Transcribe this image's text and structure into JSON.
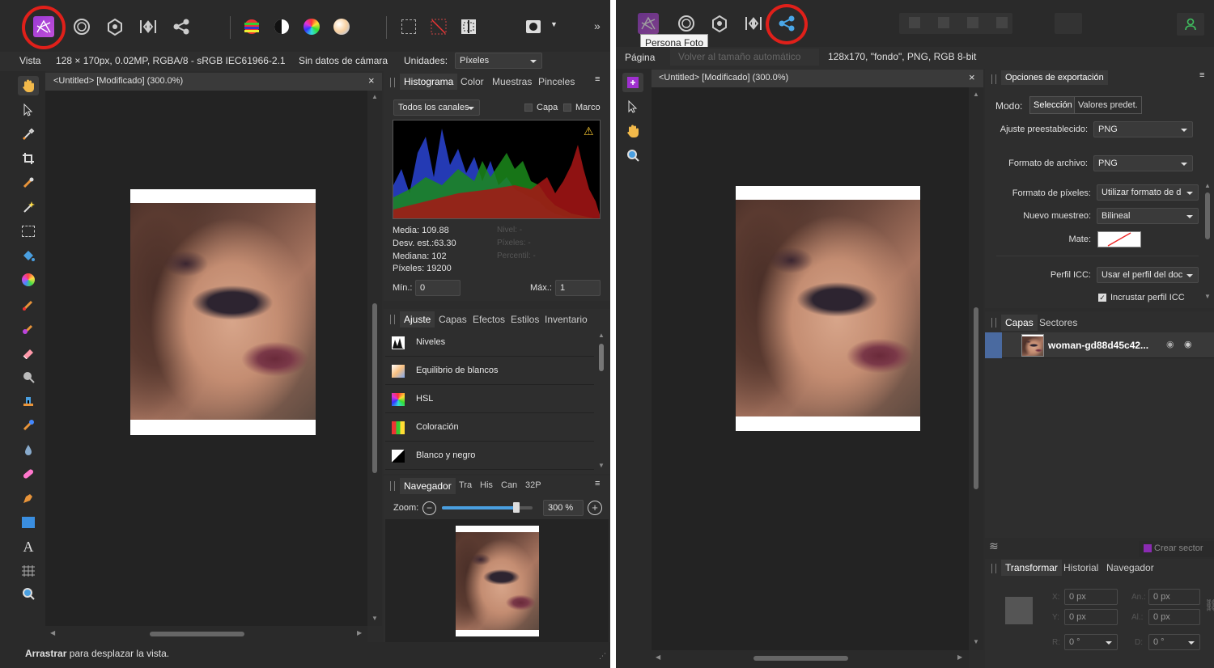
{
  "left": {
    "context": {
      "view_label": "Vista",
      "doc_info": "128 × 170px, 0.02MP, RGBA/8 - sRGB IEC61966-2.1",
      "camera": "Sin datos de cámara",
      "units_label": "Unidades:",
      "units_value": "Píxeles"
    },
    "doc_tab": "<Untitled> [Modificado] (300.0%)",
    "histogram": {
      "tabs": [
        "Histograma",
        "Color",
        "Muestras",
        "Pinceles"
      ],
      "channels": "Todos los canales",
      "layer_label": "Capa",
      "frame_label": "Marco",
      "stats": {
        "mean": "Media: 109.88",
        "stdev": "Desv. est.:63.30",
        "median": "Mediana: 102",
        "pixels": "Píxeles: 19200",
        "level": "Nivel: -",
        "pixels2": "Píxeles: -",
        "percentile": "Percentil: -"
      },
      "min_label": "Mín.:",
      "min_value": "0",
      "max_label": "Máx.:",
      "max_value": "1"
    },
    "adjust": {
      "tabs": [
        "Ajuste",
        "Capas",
        "Efectos",
        "Estilos",
        "Inventario"
      ],
      "items": [
        "Niveles",
        "Equilibrio de blancos",
        "HSL",
        "Coloración",
        "Blanco y negro"
      ]
    },
    "navigator": {
      "tabs": [
        "Navegador",
        "Tra",
        "His",
        "Can",
        "32P"
      ],
      "zoom_label": "Zoom:",
      "zoom_value": "300 %",
      "zoom_fraction": 0.82
    },
    "status_bold": "Arrastrar",
    "status_rest": " para desplazar la vista."
  },
  "right": {
    "tooltip": "Persona Foto",
    "context": {
      "page_label": "Página",
      "auto_size": "Volver al tamaño automático",
      "doc_info": "128x170, \"fondo\", PNG, RGB 8-bit"
    },
    "doc_tab": "<Untitled> [Modificado] (300.0%)",
    "export": {
      "title": "Opciones de exportación",
      "mode_label": "Modo:",
      "mode_selection": "Selección",
      "mode_presets": "Valores predet.",
      "preset_label": "Ajuste preestablecido:",
      "preset_value": "PNG",
      "format_label": "Formato de archivo:",
      "format_value": "PNG",
      "pixel_label": "Formato de píxeles:",
      "pixel_value": "Utilizar formato de d",
      "resample_label": "Nuevo muestreo:",
      "resample_value": "Bilineal",
      "matte_label": "Mate:",
      "icc_label": "Perfil ICC:",
      "icc_value": "Usar el perfil del doc",
      "embed_label": "Incrustar perfil ICC"
    },
    "layers": {
      "tabs": [
        "Capas",
        "Sectores"
      ],
      "layer_name": "woman-gd88d45c42..."
    },
    "create_slice": "Crear sector",
    "transform": {
      "tabs": [
        "Transformar",
        "Historial",
        "Navegador"
      ],
      "x_label": "X:",
      "x_value": "0 px",
      "y_label": "Y:",
      "y_value": "0 px",
      "w_label": "An.:",
      "w_value": "0 px",
      "h_label": "Al.:",
      "h_value": "0 px",
      "r_label": "R:",
      "r_value": "0 °",
      "s_label": "D:",
      "s_value": "0 °"
    }
  },
  "colors": {
    "accent_circle": "#e0201a",
    "persona_photo": "#8a2be2",
    "layer_selected": "#4a6aa0"
  }
}
